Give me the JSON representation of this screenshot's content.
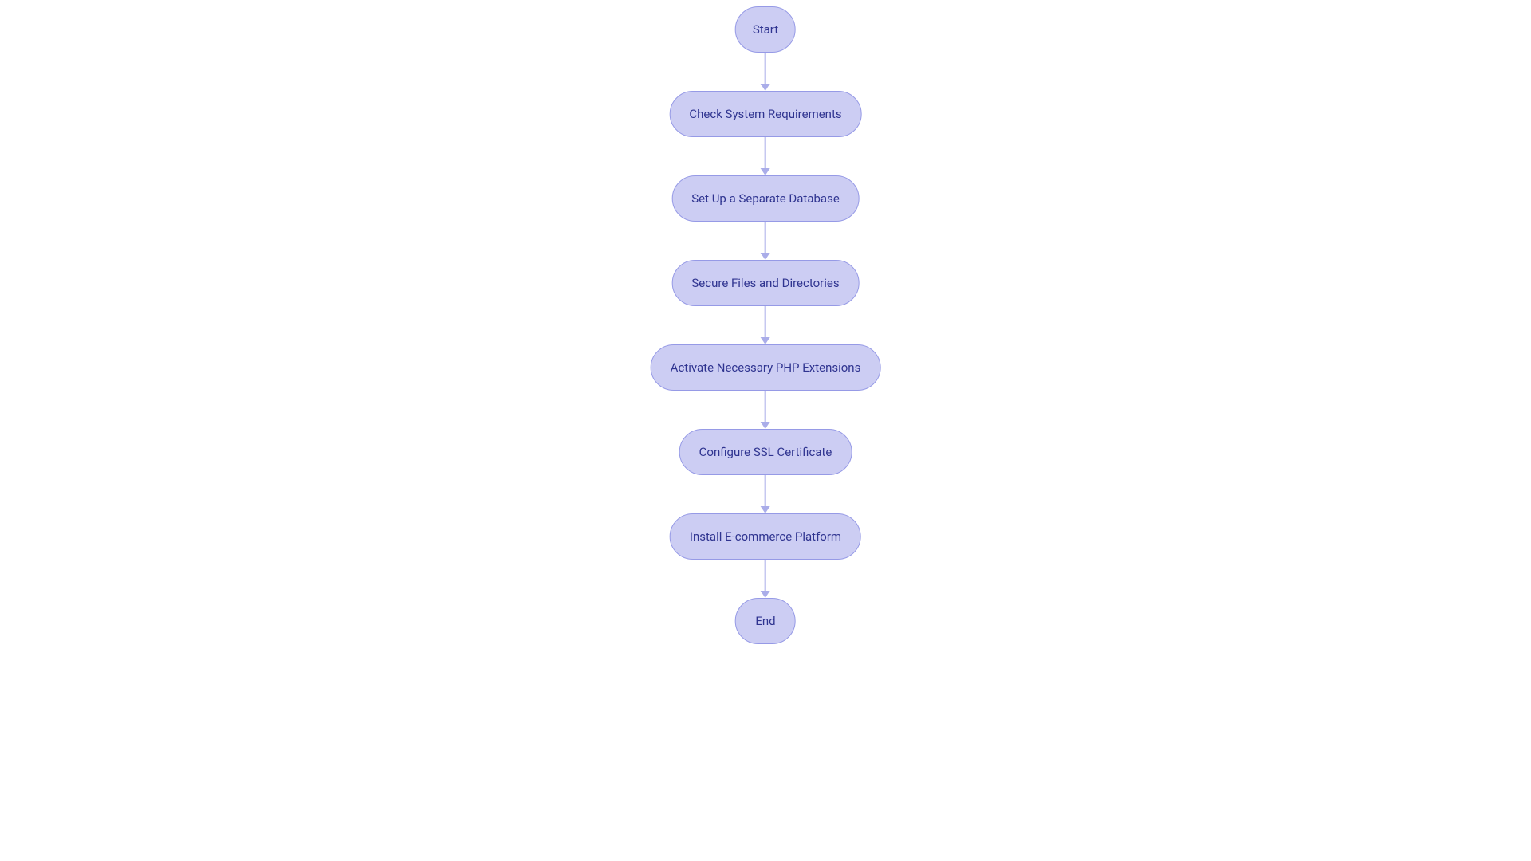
{
  "flowchart": {
    "nodes": [
      {
        "id": "start",
        "type": "terminal",
        "label": "Start"
      },
      {
        "id": "check-req",
        "type": "process",
        "label": "Check System Requirements"
      },
      {
        "id": "setup-db",
        "type": "process",
        "label": "Set Up a Separate Database"
      },
      {
        "id": "secure-files",
        "type": "process",
        "label": "Secure Files and Directories"
      },
      {
        "id": "php-ext",
        "type": "process",
        "label": "Activate Necessary PHP Extensions"
      },
      {
        "id": "ssl",
        "type": "process",
        "label": "Configure SSL Certificate"
      },
      {
        "id": "install",
        "type": "process",
        "label": "Install E-commerce Platform"
      },
      {
        "id": "end",
        "type": "terminal",
        "label": "End"
      }
    ],
    "colors": {
      "node_fill": "#cccdf3",
      "node_border": "#969ae6",
      "node_text": "#2f3490",
      "connector": "#aaade9"
    }
  }
}
